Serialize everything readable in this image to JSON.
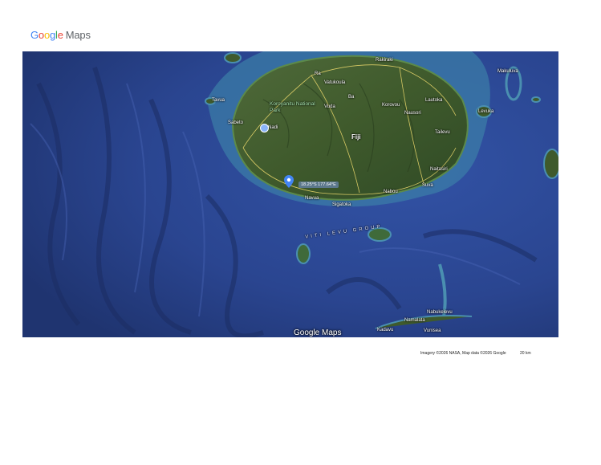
{
  "brand": {
    "logo_text": "Google",
    "logo_letters": [
      "G",
      "o",
      "o",
      "g",
      "l",
      "e"
    ],
    "product": "Maps",
    "colors": {
      "blue": "#4285F4",
      "red": "#EA4335",
      "yellow": "#FBBC05",
      "green": "#34A853"
    }
  },
  "map": {
    "view": "satellite",
    "marker": {
      "icon": "location-pin-icon",
      "color": "#4285F4"
    },
    "coordinates_label": "18.25°S 177.64°E",
    "labels": {
      "tavua": "Tavua",
      "vatukoula": "Vatukoula",
      "rakiraki": "Rakiraki",
      "koroyanitu": "Koroyanitu National Park",
      "sabeto": "Sabeto",
      "nadi": "Nadi",
      "ra": "Ra",
      "fiji": "Fiji",
      "korovou": "Korovou",
      "nausori": "Nausori",
      "suva": "Suva",
      "navua": "Navua",
      "sigatoka": "Sigatoka",
      "vuda": "Vuda",
      "nabou": "Nabou",
      "ba": "Ba",
      "lautoka": "Lautoka",
      "tailevu": "Tailevu",
      "naitasiri": "Naitasiri",
      "makuluva": "Makuluva",
      "levuka": "Levuka",
      "nabukelevu": "Nabukelevu",
      "kadavu": "Kadavu",
      "namalata": "Namalata",
      "vunisea": "Vunisea",
      "group": "VITI LEVU GROUP"
    },
    "watermark": "Google Maps"
  },
  "footer": {
    "attribution": "Imagery ©2026 NASA, Map data ©2026 Google",
    "scale": "20 km"
  }
}
